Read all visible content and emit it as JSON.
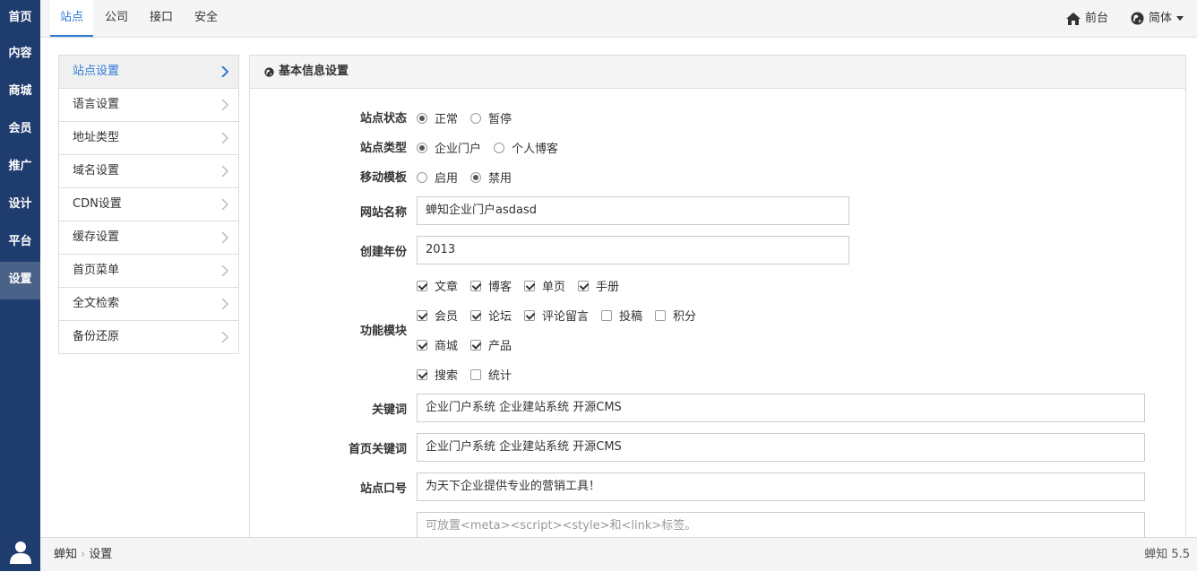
{
  "left_nav": [
    {
      "label": "首页"
    },
    {
      "label": "内容"
    },
    {
      "label": "商城"
    },
    {
      "label": "会员"
    },
    {
      "label": "推广"
    },
    {
      "label": "设计"
    },
    {
      "label": "平台"
    },
    {
      "label": "设置"
    }
  ],
  "top_tabs": [
    {
      "label": "站点"
    },
    {
      "label": "公司"
    },
    {
      "label": "接口"
    },
    {
      "label": "安全"
    }
  ],
  "top_right": {
    "frontend": "前台",
    "language": "简体"
  },
  "submenu": [
    {
      "label": "站点设置"
    },
    {
      "label": "语言设置"
    },
    {
      "label": "地址类型"
    },
    {
      "label": "域名设置"
    },
    {
      "label": "CDN设置"
    },
    {
      "label": "缓存设置"
    },
    {
      "label": "首页菜单"
    },
    {
      "label": "全文检索"
    },
    {
      "label": "备份还原"
    }
  ],
  "panel": {
    "title": "基本信息设置"
  },
  "form": {
    "site_status": {
      "label": "站点状态",
      "options": [
        "正常",
        "暂停"
      ],
      "selected": "正常"
    },
    "site_type": {
      "label": "站点类型",
      "options": [
        "企业门户",
        "个人博客"
      ],
      "selected": "企业门户"
    },
    "mobile_template": {
      "label": "移动模板",
      "options": [
        "启用",
        "禁用"
      ],
      "selected": "禁用"
    },
    "site_name": {
      "label": "网站名称",
      "value": "蝉知企业门户asdasd"
    },
    "created_year": {
      "label": "创建年份",
      "value": "2013"
    },
    "modules": {
      "label": "功能模块",
      "items": [
        {
          "label": "文章",
          "checked": true
        },
        {
          "label": "博客",
          "checked": true
        },
        {
          "label": "单页",
          "checked": true
        },
        {
          "label": "手册",
          "checked": true
        },
        {
          "label": "会员",
          "checked": true
        },
        {
          "label": "论坛",
          "checked": true
        },
        {
          "label": "评论留言",
          "checked": true
        },
        {
          "label": "投稿",
          "checked": false
        },
        {
          "label": "积分",
          "checked": false
        },
        {
          "label": "商城",
          "checked": true
        },
        {
          "label": "产品",
          "checked": true
        },
        {
          "label": "搜索",
          "checked": true
        },
        {
          "label": "统计",
          "checked": false
        }
      ]
    },
    "keywords": {
      "label": "关键词",
      "value": "企业门户系统 企业建站系统 开源CMS"
    },
    "home_keywords": {
      "label": "首页关键词",
      "value": "企业门户系统 企业建站系统 开源CMS"
    },
    "slogan": {
      "label": "站点口号",
      "value": "为天下企业提供专业的营销工具！"
    },
    "meta": {
      "placeholder": "可放置<meta><script><style>和<link>标签。"
    }
  },
  "footer": {
    "crumbs": [
      "蝉知",
      "设置"
    ],
    "version": "蝉知 5.5"
  },
  "colors": {
    "nav_bg": "#1f3c6e",
    "accent": "#2f7ad9",
    "nav_active": "#4a6288"
  }
}
